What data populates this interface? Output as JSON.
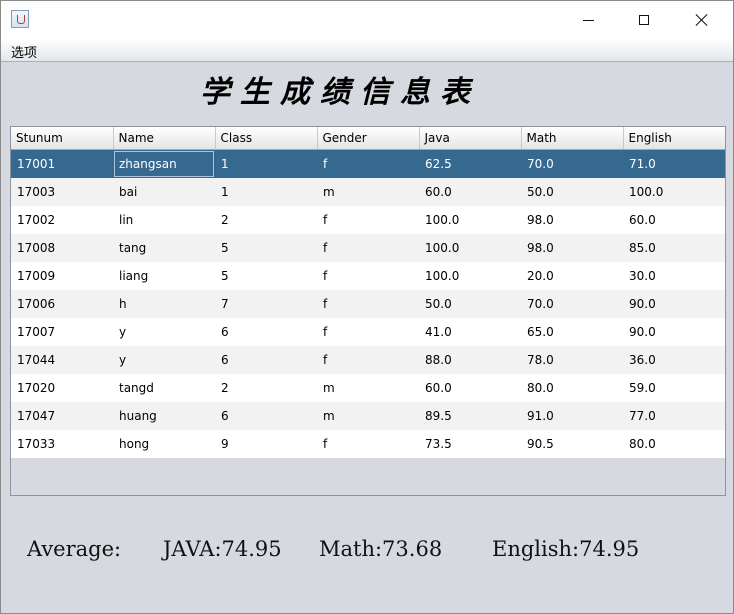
{
  "window": {
    "minimize": "minimize",
    "maximize": "maximize",
    "close": "close"
  },
  "menu": {
    "items": [
      "选项"
    ]
  },
  "title": "学生成绩信息表",
  "table": {
    "columns": [
      "Stunum",
      "Name",
      "Class",
      "Gender",
      "Java",
      "Math",
      "English"
    ],
    "selected_row": 0,
    "rows": [
      [
        "17001",
        "zhangsan",
        "1",
        "f",
        "62.5",
        "70.0",
        "71.0"
      ],
      [
        "17003",
        "bai",
        "1",
        "m",
        "60.0",
        "50.0",
        "100.0"
      ],
      [
        "17002",
        "lin",
        "2",
        "f",
        "100.0",
        "98.0",
        "60.0"
      ],
      [
        "17008",
        "tang",
        "5",
        "f",
        "100.0",
        "98.0",
        "85.0"
      ],
      [
        "17009",
        "liang",
        "5",
        "f",
        "100.0",
        "20.0",
        "30.0"
      ],
      [
        "17006",
        "h",
        "7",
        "f",
        "50.0",
        "70.0",
        "90.0"
      ],
      [
        "17007",
        "y",
        "6",
        "f",
        "41.0",
        "65.0",
        "90.0"
      ],
      [
        "17044",
        "y",
        "6",
        "f",
        "88.0",
        "78.0",
        "36.0"
      ],
      [
        "17020",
        "tangd",
        "2",
        "m",
        "60.0",
        "80.0",
        "59.0"
      ],
      [
        "17047",
        "huang",
        "6",
        "m",
        "89.5",
        "91.0",
        "77.0"
      ],
      [
        "17033",
        "hong",
        "9",
        "f",
        "73.5",
        "90.5",
        "80.0"
      ]
    ]
  },
  "averages": {
    "label": "Average:",
    "java": "JAVA:74.95",
    "math": "Math:73.68",
    "english": "English:74.95"
  }
}
